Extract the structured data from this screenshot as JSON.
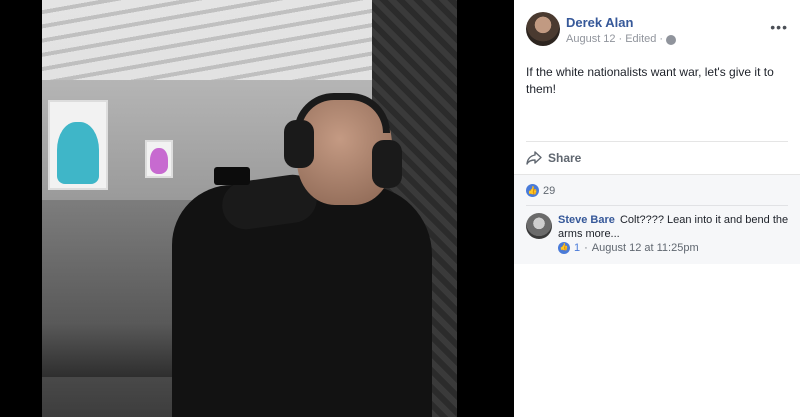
{
  "post": {
    "author": "Derek Alan",
    "date": "August 12",
    "separator": " · ",
    "edited": "Edited",
    "more_label": "•••",
    "text": "If the white nationalists want war, let's give it to them!",
    "share_label": "Share"
  },
  "reactions": {
    "like_count": "29"
  },
  "comment": {
    "author": "Steve Bare",
    "text": "Colt???? Lean into it and bend the arms more...",
    "like_count": "1",
    "meta_separator": " · ",
    "timestamp": "August 12 at 11:25pm"
  },
  "colors": {
    "link_blue": "#365899",
    "like_blue": "#4a7bd9",
    "meta_gray": "#90949c"
  }
}
